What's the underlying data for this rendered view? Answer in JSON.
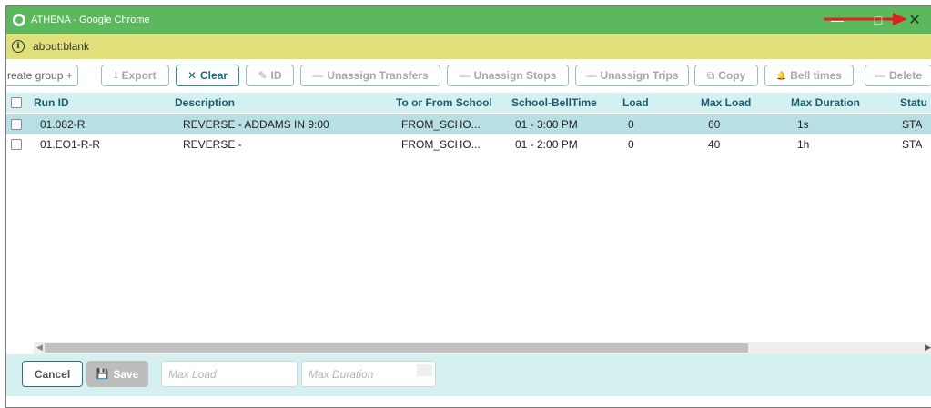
{
  "window": {
    "title": "ATHENA - Google Chrome",
    "minimize_glyph": "—",
    "maximize_glyph": "□",
    "close_glyph": "✕"
  },
  "address": {
    "info_glyph": "i",
    "url": "about:blank"
  },
  "toolbar": {
    "create_group": "reate group +",
    "export": "Export",
    "export_icon": "⭳",
    "clear": "Clear",
    "clear_icon": "✕",
    "id": "ID",
    "id_icon": "✎",
    "unassign_transfers": "Unassign Transfers",
    "unassign_stops": "Unassign Stops",
    "unassign_trips": "Unassign Trips",
    "copy": "Copy",
    "copy_icon": "⧉",
    "bell_times": "Bell times",
    "bell_icon": "🔔",
    "delete": "Delete",
    "dash": "—"
  },
  "grid": {
    "columns": [
      "Run ID",
      "Description",
      "To or From School",
      "School-BellTime",
      "Load",
      "Max Load",
      "Max Duration",
      "Statu"
    ],
    "rows": [
      {
        "run_id": "01.082-R",
        "description": "REVERSE - ADDAMS IN 9:00",
        "to_from": "FROM_SCHO...",
        "bell": "01 - 3:00 PM",
        "load": "0",
        "max_load": "60",
        "max_duration": "1s",
        "status": "STA",
        "selected": true
      },
      {
        "run_id": "01.EO1-R-R",
        "description": "REVERSE -",
        "to_from": "FROM_SCHO...",
        "bell": "01 - 2:00 PM",
        "load": "0",
        "max_load": "40",
        "max_duration": "1h",
        "status": "STA",
        "selected": false
      }
    ]
  },
  "footer": {
    "cancel": "Cancel",
    "save": "Save",
    "save_icon": "💾",
    "max_load_placeholder": "Max Load",
    "max_duration_placeholder": "Max Duration"
  },
  "colors": {
    "titlebar": "#5cb85c",
    "addressbar": "#dfe07a",
    "header_bg": "#d4f0f0",
    "selected_row": "#b8dfe4",
    "accent": "#1b6f7a",
    "annotation_arrow": "#e02020"
  }
}
